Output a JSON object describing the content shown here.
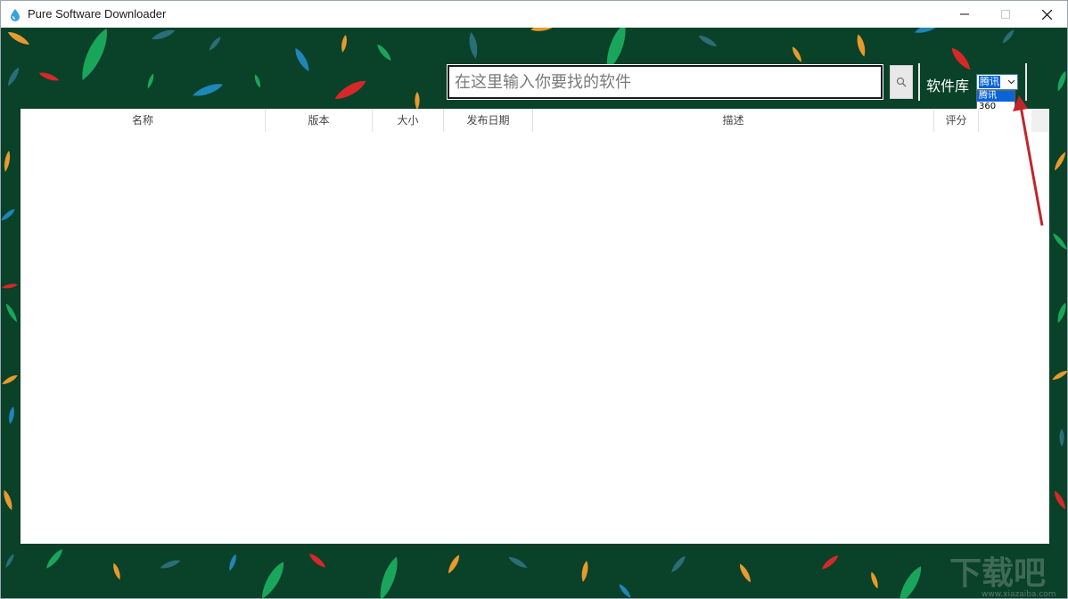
{
  "window": {
    "title": "Pure Software Downloader",
    "icon": "water-drop-icon"
  },
  "controls": {
    "minimize": "minimize-icon",
    "maximize": "maximize-icon",
    "close": "close-icon"
  },
  "search": {
    "placeholder": "在这里输入你要找的软件",
    "value": "",
    "button_icon": "search-icon"
  },
  "library": {
    "label": "软件库",
    "selected": "腾讯",
    "options": [
      "腾讯",
      "360"
    ]
  },
  "table": {
    "columns": [
      "名称",
      "版本",
      "大小",
      "发布日期",
      "描述",
      "评分"
    ],
    "rows": []
  },
  "colors": {
    "background": "#0a4129",
    "accent": "#0a64d6",
    "annotation_arrow": "#c0262c"
  }
}
